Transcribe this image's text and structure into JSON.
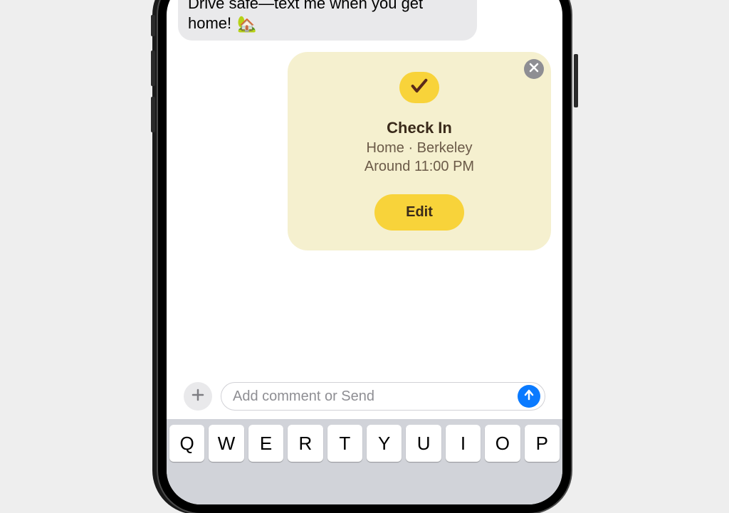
{
  "message": {
    "text": "Drive safe—text me when you get home! ",
    "emoji": "🏡"
  },
  "checkin": {
    "title": "Check In",
    "location": "Home · Berkeley",
    "time": "Around 11:00 PM",
    "edit_label": "Edit"
  },
  "compose": {
    "placeholder": "Add comment or Send"
  },
  "keyboard": {
    "row1": [
      "Q",
      "W",
      "E",
      "R",
      "T",
      "Y",
      "U",
      "I",
      "O",
      "P"
    ]
  }
}
